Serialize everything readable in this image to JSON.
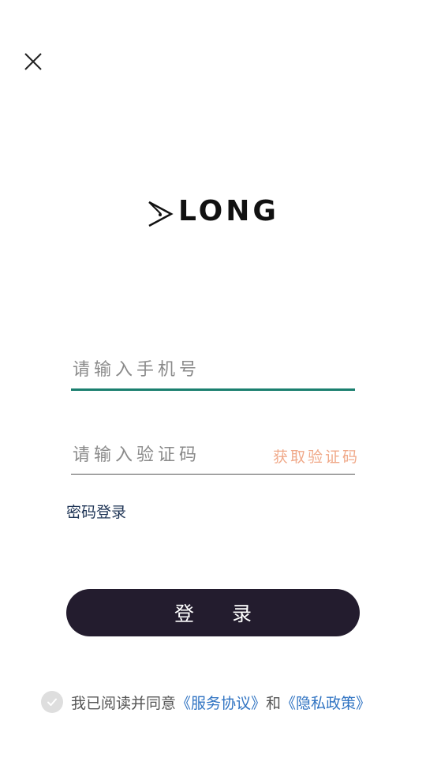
{
  "header": {
    "close_icon": "close-icon"
  },
  "logo": {
    "text": "LONG",
    "mark_icon": "triangle-eye-icon"
  },
  "form": {
    "phone_placeholder": "请输入手机号",
    "phone_value": "",
    "code_placeholder": "请输入验证码",
    "code_value": "",
    "get_code_label": "获取验证码",
    "password_login_label": "密码登录",
    "login_label": "登录"
  },
  "agreement": {
    "checked": true,
    "prefix": "我已阅读并同意",
    "service_link": "《服务协议》",
    "and": "和",
    "privacy_link": "《隐私政策》"
  },
  "colors": {
    "accent": "#1a7f6f",
    "button_bg": "#231c2e",
    "get_code": "#f0a989",
    "link": "#2f73c2",
    "password_login": "#1f3556"
  }
}
